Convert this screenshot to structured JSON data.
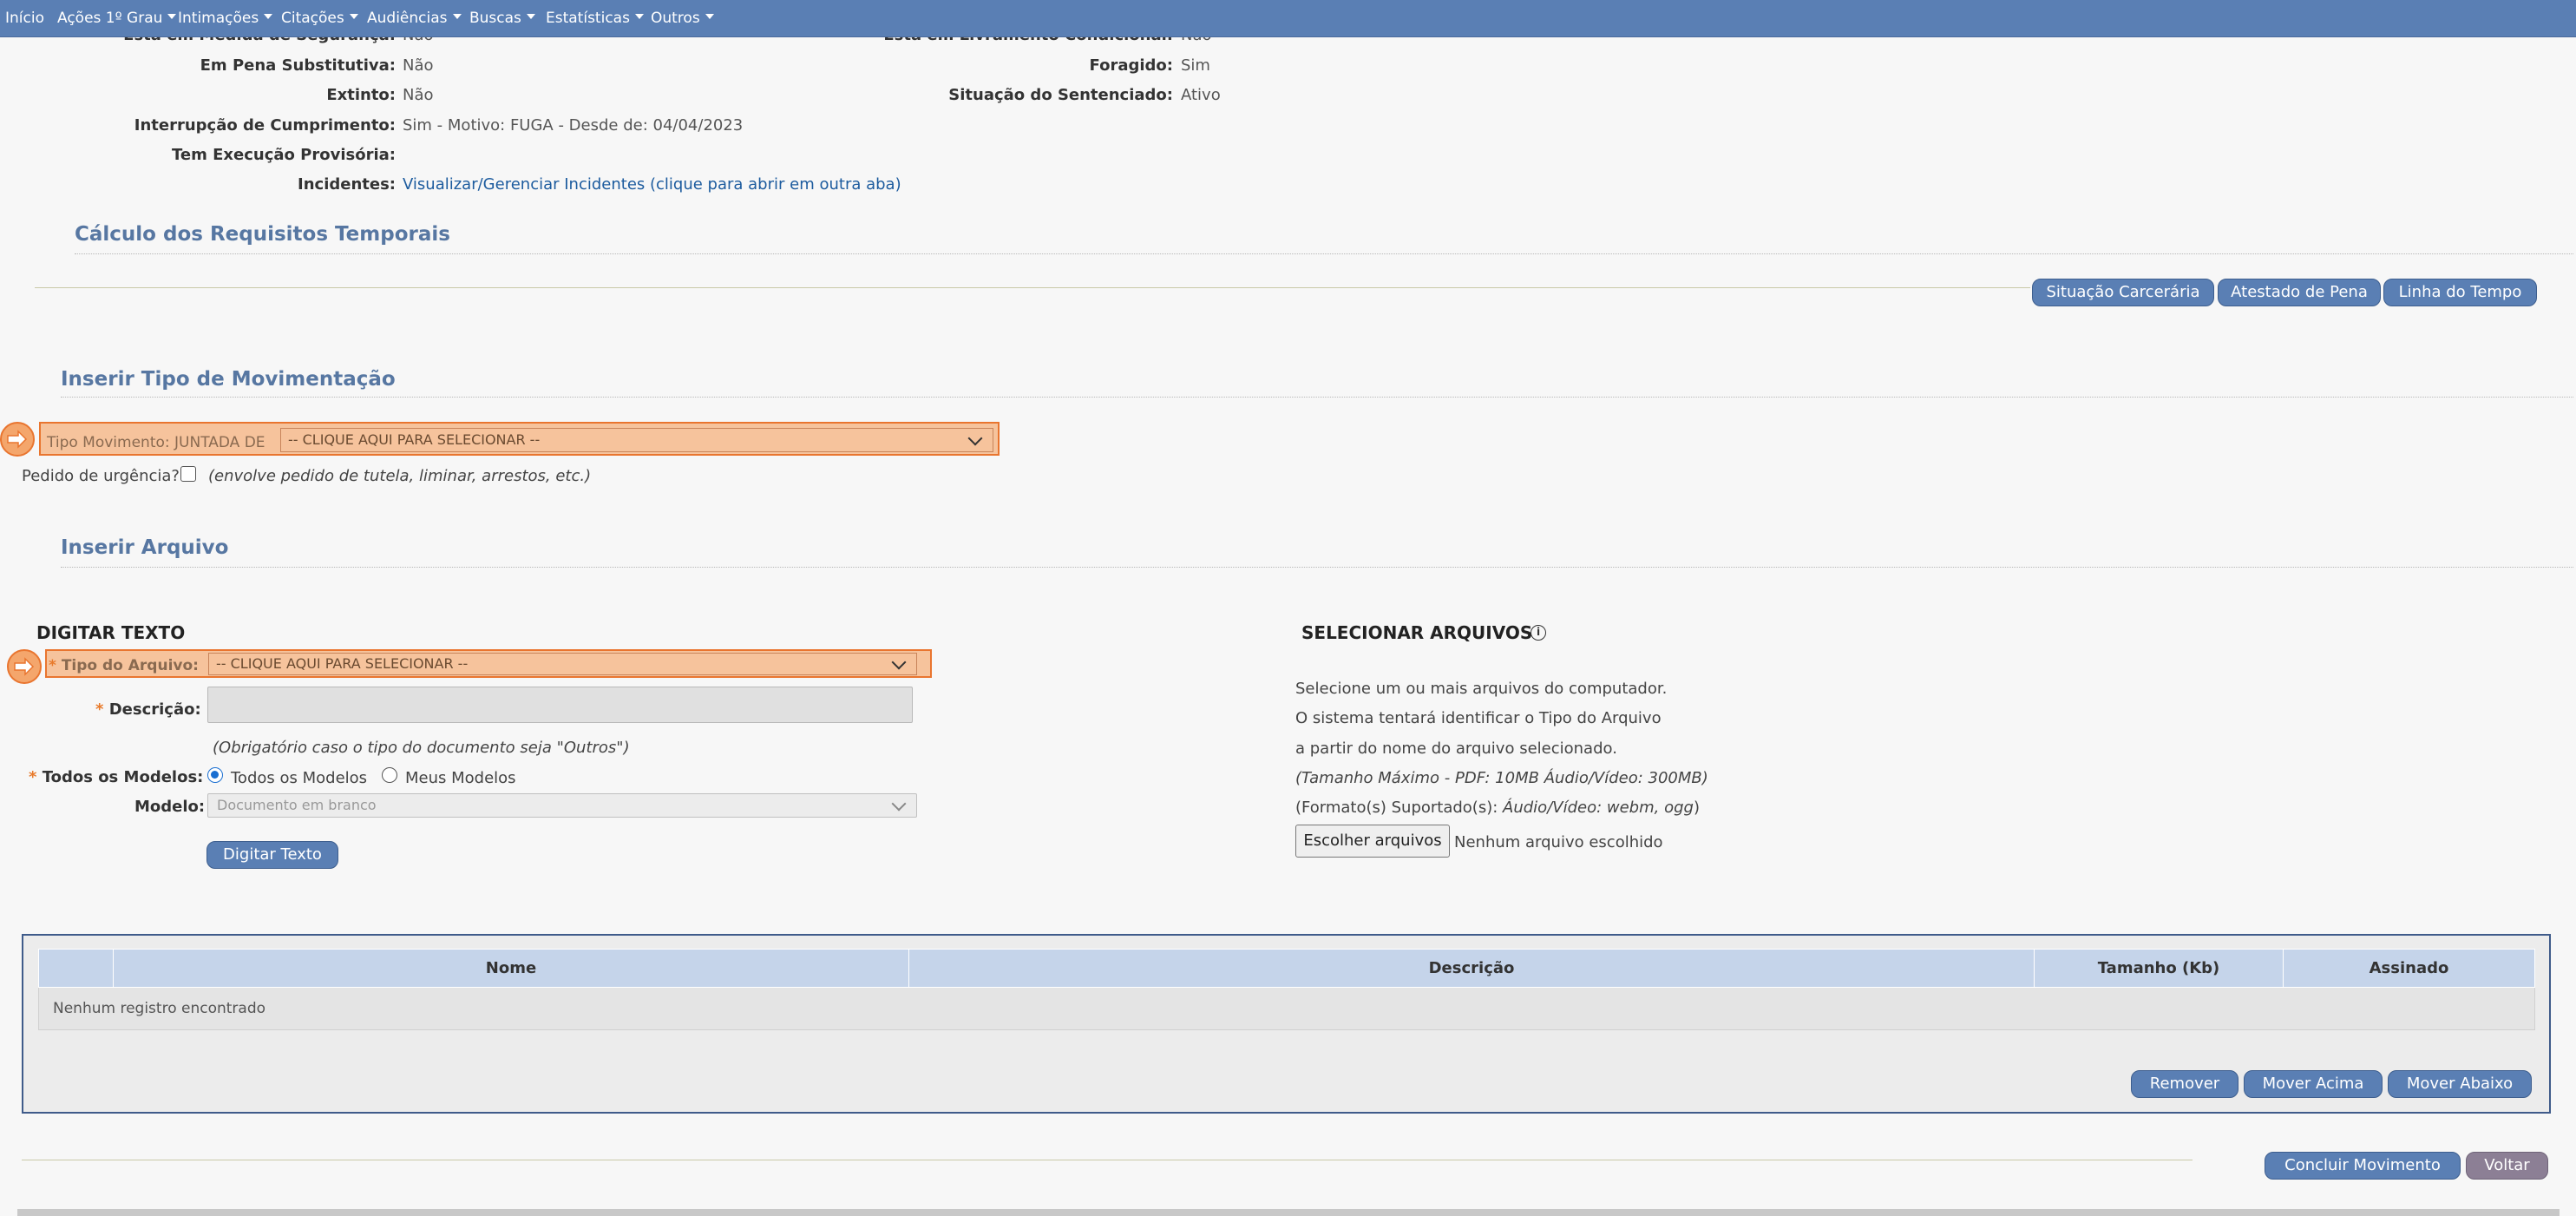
{
  "nav": {
    "items": [
      {
        "label": "Início",
        "dropdown": false
      },
      {
        "label": "Ações 1º Grau",
        "dropdown": true
      },
      {
        "label": "Intimações",
        "dropdown": true
      },
      {
        "label": "Citações",
        "dropdown": true
      },
      {
        "label": "Audiências",
        "dropdown": true
      },
      {
        "label": "Buscas",
        "dropdown": true
      },
      {
        "label": "Estatísticas",
        "dropdown": true
      },
      {
        "label": "Outros",
        "dropdown": true
      }
    ]
  },
  "info": {
    "seguranca": {
      "label": "Está em Medida de Segurança:",
      "value": "Não"
    },
    "livramento": {
      "label": "Está em Livramento Condicional:",
      "value": "Não"
    },
    "pena_substitutiva": {
      "label": "Em Pena Substitutiva:",
      "value": "Não"
    },
    "foragido": {
      "label": "Foragido:",
      "value": "Sim"
    },
    "extinto": {
      "label": "Extinto:",
      "value": "Não"
    },
    "situacao_sentenciado": {
      "label": "Situação do Sentenciado:",
      "value": "Ativo"
    },
    "interrupcao": {
      "label": "Interrupção de Cumprimento:",
      "value": "Sim - Motivo: FUGA - Desde de: 04/04/2023"
    },
    "execucao_provisoria": {
      "label": "Tem Execução Provisória:",
      "value": ""
    },
    "incidentes": {
      "label": "Incidentes:",
      "value": "Visualizar/Gerenciar Incidentes (clique para abrir em outra aba)"
    }
  },
  "calculo": {
    "title": "Cálculo dos Requisitos Temporais",
    "buttons": {
      "situacao": "Situação Carcerária",
      "atestado": "Atestado de Pena",
      "linha": "Linha do Tempo"
    }
  },
  "movimentacao": {
    "title": "Inserir Tipo de Movimentação",
    "tipo_label": "Tipo Movimento: JUNTADA DE",
    "tipo_select": "-- CLIQUE AQUI PARA SELECIONAR --",
    "urgencia_label": "Pedido de urgência?",
    "urgencia_note": "(envolve pedido de tutela, liminar, arrestos, etc.)"
  },
  "arquivo": {
    "title": "Inserir Arquivo",
    "digitar": {
      "heading": "DIGITAR TEXTO",
      "tipo_label": "Tipo do Arquivo:",
      "tipo_select": "-- CLIQUE AQUI PARA SELECIONAR --",
      "descricao_label": "Descrição:",
      "descricao_hint": "(Obrigatório caso o tipo do documento seja \"Outros\")",
      "modelos_label": "Todos os Modelos:",
      "radio_todos": "Todos os Modelos",
      "radio_meus": "Meus Modelos",
      "modelo_label": "Modelo:",
      "modelo_select": "Documento em branco",
      "button": "Digitar Texto"
    },
    "selecionar": {
      "heading": "SELECIONAR ARQUIVOS",
      "line1": "Selecione um ou mais arquivos do computador.",
      "line2": "O sistema tentará identificar o Tipo do Arquivo",
      "line3": "a partir do nome do arquivo selecionado.",
      "line4": "(Tamanho Máximo - PDF: 10MB  Áudio/Vídeo: 300MB)",
      "line5_prefix": "(Formato(s) Suportado(s): ",
      "line5_italic": "Áudio/Vídeo: webm, ogg",
      "line5_suffix": ")",
      "file_button": "Escolher arquivos",
      "file_status": "Nenhum arquivo escolhido"
    }
  },
  "table": {
    "columns": [
      "",
      "Nome",
      "Descrição",
      "Tamanho (Kb)",
      "Assinado"
    ],
    "empty": "Nenhum registro encontrado",
    "buttons": {
      "remover": "Remover",
      "acima": "Mover Acima",
      "abaixo": "Mover Abaixo"
    }
  },
  "footer": {
    "concluir": "Concluir Movimento",
    "voltar": "Voltar"
  },
  "colors": {
    "nav": "#5a7fb4",
    "button": "#5a7fb4",
    "highlight": "#f6c39c",
    "highlight_border": "#e9752f",
    "section_title": "#5777a2"
  }
}
